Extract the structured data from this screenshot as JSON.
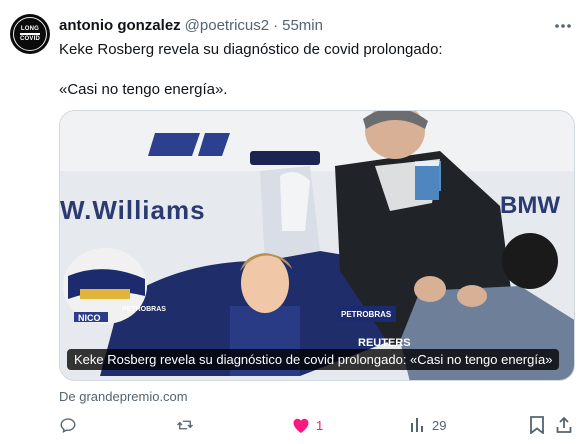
{
  "post": {
    "avatar": {
      "line1": "LONG",
      "line2": "COVID"
    },
    "author_name": "antonio gonzalez",
    "author_handle": "@poetricus2",
    "separator": "·",
    "time": "55min",
    "text_line1": "Keke Rosberg revela su diagnóstico de covid prolongado:",
    "text_line2": "«Casi no tengo energía».",
    "media": {
      "caption": "Keke Rosberg revela su diagnóstico de covid prolongado: «Casi no tengo energía»",
      "banner_text_left": "W.Williams",
      "banner_text_right": "BMW",
      "car_labels": [
        "NICO",
        "PETROBRAS",
        "PETROBRAS",
        "REUTERS"
      ]
    },
    "source": "De grandepremio.com",
    "actions": {
      "reply_icon": "reply-icon",
      "repost_icon": "repost-icon",
      "like_icon": "heart-filled-icon",
      "like_count": "1",
      "views_icon": "views-bar-chart-icon",
      "views_count": "29",
      "bookmark_icon": "bookmark-icon",
      "share_icon": "share-icon"
    },
    "colors": {
      "like": "#f91880",
      "secondary_text": "#536471",
      "primary_text": "#0f1419"
    }
  }
}
